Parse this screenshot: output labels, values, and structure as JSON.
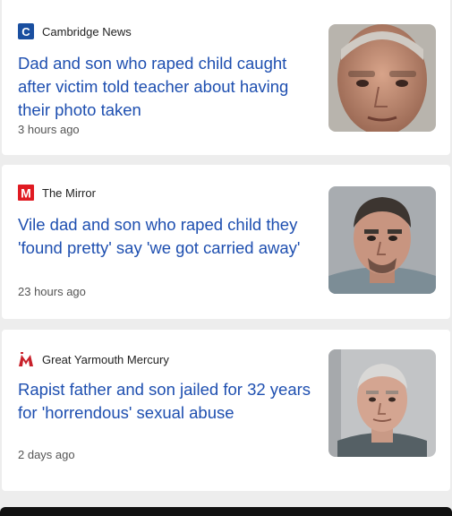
{
  "articles": [
    {
      "source": "Cambridge News",
      "logo_icon": "cambridge-news-logo-icon",
      "logo_color": "#1a4fa0",
      "headline": "Dad and son who raped child caught after victim told teacher about having their photo taken",
      "time": "3 hours ago"
    },
    {
      "source": "The Mirror",
      "logo_icon": "the-mirror-logo-icon",
      "logo_color": "#e01a22",
      "headline": "Vile dad and son who raped child they 'found pretty' say 'we got carried away'",
      "time": "23 hours ago"
    },
    {
      "source": "Great Yarmouth Mercury",
      "logo_icon": "great-yarmouth-mercury-logo-icon",
      "logo_color": "#c8202a",
      "headline": "Rapist father and son jailed for 32 years for 'horrendous' sexual abuse",
      "time": "2 days ago"
    }
  ],
  "colors": {
    "headline": "#1e4fb0",
    "background": "#ededed",
    "card": "#ffffff"
  }
}
